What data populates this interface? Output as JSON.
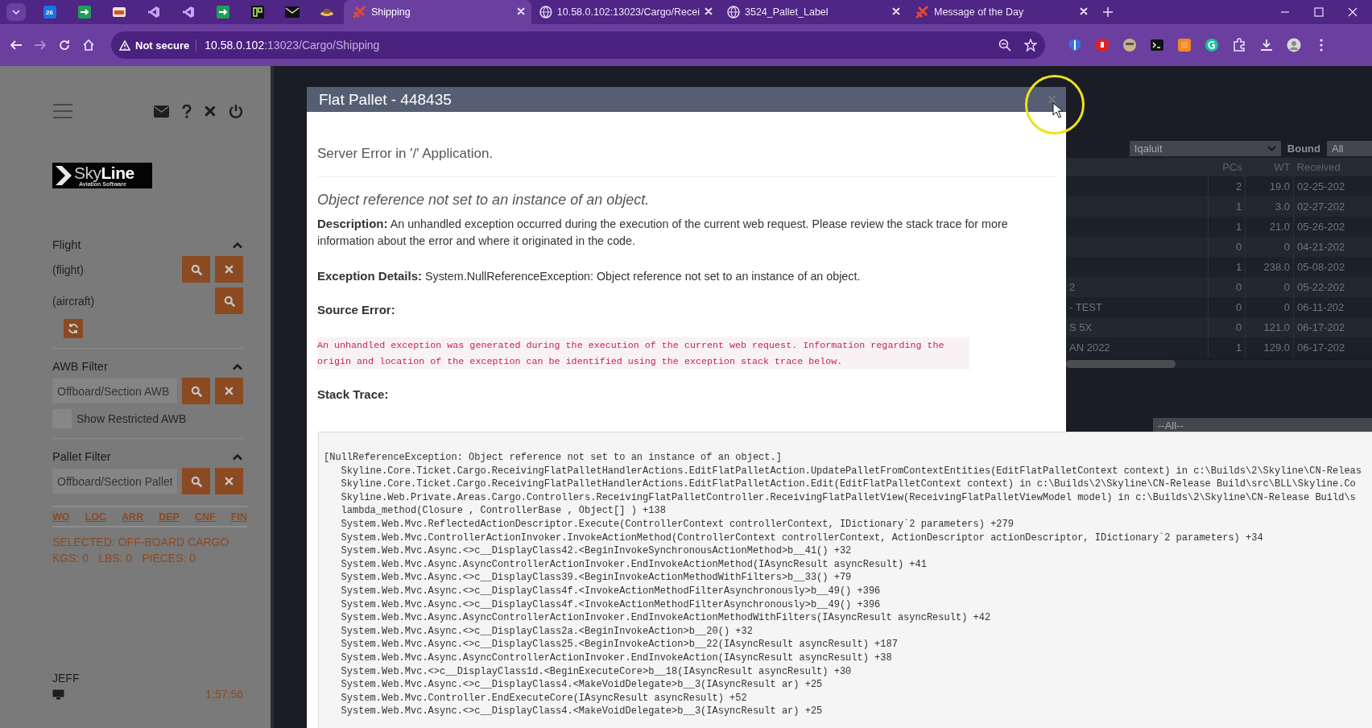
{
  "browser": {
    "pinned_tabs": [
      {
        "kind": "calendar",
        "label": "26"
      },
      {
        "kind": "arrow"
      },
      {
        "kind": "badge"
      },
      {
        "kind": "studio"
      },
      {
        "kind": "studio"
      },
      {
        "kind": "arrow"
      },
      {
        "kind": "grid"
      },
      {
        "kind": "mail"
      },
      {
        "kind": "hat"
      }
    ],
    "tabs": [
      {
        "title": "Shipping",
        "kind": "app",
        "selected": true
      },
      {
        "title": "10.58.0.102:13023/Cargo/Recei",
        "kind": "globe",
        "selected": false
      },
      {
        "title": "3524_Pallet_Label",
        "kind": "globe",
        "selected": false
      },
      {
        "title": "Message of the Day",
        "kind": "app",
        "selected": false
      }
    ],
    "security": "Not secure",
    "host": "10.58.0.102",
    "path": ":13023/Cargo/Shipping"
  },
  "sidebar": {
    "logo": "Sky**Line**",
    "logo_tagline": "Aviation Software",
    "flight": {
      "title": "Flight",
      "expanded": true,
      "flight": "(flight)",
      "aircraft": "(aircraft)"
    },
    "awb_filter": {
      "title": "AWB Filter",
      "expanded": true,
      "placeholder": "Offboard/Section AWB",
      "restricted": {
        "label": "Show Restricted AWB",
        "checked": false
      }
    },
    "pallet_filter": {
      "title": "Pallet Filter",
      "expanded": true,
      "placeholder": "Offboard/Section Pallet"
    },
    "links": [
      "WO",
      "LOC",
      "ARR",
      "DEP",
      "CNF",
      "FIN"
    ],
    "selected": "SELECTED: OFF-BOARD CARGO",
    "totals": [
      "KGS: 0",
      "LBS: 0",
      "PIECES: 0"
    ],
    "user": "JEFF",
    "time": "1:57:56"
  },
  "background": {
    "station": "Iqaluit",
    "bound_label": "Bound",
    "bound": "All",
    "table": {
      "columns": [
        "PCs",
        "WT",
        "Received"
      ],
      "rows": [
        {
          "pcs": "2",
          "wt": "19.0",
          "received": "02-25-202"
        },
        {
          "pcs": "1",
          "wt": "3.0",
          "received": "02-27-202"
        },
        {
          "pcs": "1",
          "wt": "21.0",
          "received": "05-26-202"
        },
        {
          "pcs": "0",
          "wt": "0",
          "received": "04-21-202"
        },
        {
          "pcs": "1",
          "wt": "238.0",
          "received": "05-08-202"
        },
        {
          "column_1": "2",
          "pcs": "0",
          "wt": "0",
          "received": "05-22-202"
        },
        {
          "column_1": "- TEST",
          "pcs": "0",
          "wt": "0",
          "received": "06-11-202"
        },
        {
          "column_1": "S 5X",
          "pcs": "0",
          "wt": "121.0",
          "received": "06-17-202"
        },
        {
          "column_1": "AN 2022",
          "pcs": "1",
          "wt": "129.0",
          "received": "06-17-202"
        }
      ]
    },
    "lower_filter": "--All--"
  },
  "modal": {
    "title": "Flat Pallet - 448435",
    "heading": "Server Error in '/' Application.",
    "message": "Object reference not set to an instance of an object.",
    "description": "**Description:** An unhandled exception occurred during the execution of the current web request. Please review the stack trace for more information about the error and where it originated in the code.",
    "exception": "**Exception Details:** System.NullReferenceException: Object reference not set to an instance of an object.",
    "source_label": "Source Error:",
    "source": "An unhandled exception was generated during the execution of the current web request. Information regarding the origin and location of the exception can be identified using the exception stack trace below.",
    "stack_label": "Stack Trace:",
    "stack": [
      "[NullReferenceException: Object reference not set to an instance of an object.]",
      "   Skyline.Core.Ticket.Cargo.ReceivingFlatPalletHandlerActions.EditFlatPalletAction.UpdatePalletFromContextEntities(EditFlatPalletContext context) in c:\\Builds\\2\\Skyline\\CN-Releas",
      "   Skyline.Core.Ticket.Cargo.ReceivingFlatPalletHandlerActions.EditFlatPalletAction.Edit(EditFlatPalletContext context) in c:\\Builds\\2\\Skyline\\CN-Release Build\\src\\BLL\\Skyline.Co",
      "   Skyline.Web.Private.Areas.Cargo.Controllers.ReceivingFlatPalletController.ReceivingFlatPalletView(ReceivingFlatPalletViewModel model) in c:\\Builds\\2\\Skyline\\CN-Release Build\\s",
      "   lambda_method(Closure , ControllerBase , Object[] ) +138",
      "   System.Web.Mvc.ReflectedActionDescriptor.Execute(ControllerContext controllerContext, IDictionary`2 parameters) +279",
      "   System.Web.Mvc.ControllerActionInvoker.InvokeActionMethod(ControllerContext controllerContext, ActionDescriptor actionDescriptor, IDictionary`2 parameters) +34",
      "   System.Web.Mvc.Async.<>c__DisplayClass42.<BeginInvokeSynchronousActionMethod>b__41() +32",
      "   System.Web.Mvc.Async.AsyncControllerActionInvoker.EndInvokeActionMethod(IAsyncResult asyncResult) +41",
      "   System.Web.Mvc.Async.<>c__DisplayClass39.<BeginInvokeActionMethodWithFilters>b__33() +79",
      "   System.Web.Mvc.Async.<>c__DisplayClass4f.<InvokeActionMethodFilterAsynchronously>b__49() +396",
      "   System.Web.Mvc.Async.<>c__DisplayClass4f.<InvokeActionMethodFilterAsynchronously>b__49() +396",
      "   System.Web.Mvc.Async.AsyncControllerActionInvoker.EndInvokeActionMethodWithFilters(IAsyncResult asyncResult) +42",
      "   System.Web.Mvc.Async.<>c__DisplayClass2a.<BeginInvokeAction>b__20() +32",
      "   System.Web.Mvc.Async.<>c__DisplayClass25.<BeginInvokeAction>b__22(IAsyncResult asyncResult) +187",
      "   System.Web.Mvc.Async.AsyncControllerActionInvoker.EndInvokeAction(IAsyncResult asyncResult) +38",
      "   System.Web.Mvc.<>c__DisplayClass1d.<BeginExecuteCore>b__18(IAsyncResult asyncResult) +30",
      "   System.Web.Mvc.Async.<>c__DisplayClass4.<MakeVoidDelegate>b__3(IAsyncResult ar) +25",
      "   System.Web.Mvc.Controller.EndExecuteCore(IAsyncResult asyncResult) +52",
      "   System.Web.Mvc.Async.<>c__DisplayClass4.<MakeVoidDelegate>b__3(IAsyncResult ar) +25"
    ]
  }
}
